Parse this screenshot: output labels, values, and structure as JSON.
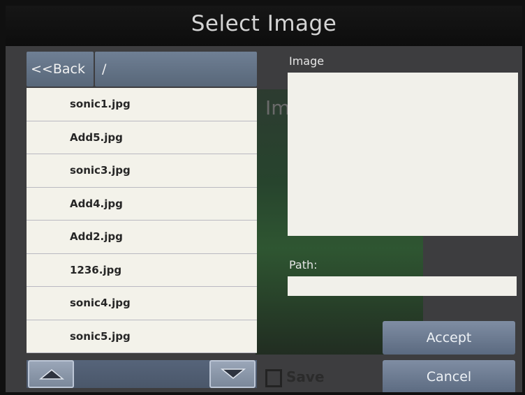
{
  "dialog": {
    "title": "Select Image"
  },
  "navigation": {
    "back_label": "<<Back",
    "current_path": "/"
  },
  "files": [
    {
      "name": "sonic1.jpg"
    },
    {
      "name": "Add5.jpg"
    },
    {
      "name": "sonic3.jpg"
    },
    {
      "name": "Add4.jpg"
    },
    {
      "name": "Add2.jpg"
    },
    {
      "name": "1236.jpg"
    },
    {
      "name": "sonic4.jpg"
    },
    {
      "name": "sonic5.jpg"
    }
  ],
  "preview": {
    "image_label": "Image",
    "path_label": "Path:",
    "path_value": ""
  },
  "actions": {
    "accept_label": "Accept",
    "cancel_label": "Cancel"
  },
  "background": {
    "behind_label": "Im",
    "save_label": "Save"
  },
  "icons": {
    "scroll_up": "triangle-up-icon",
    "scroll_down": "triangle-down-icon"
  }
}
